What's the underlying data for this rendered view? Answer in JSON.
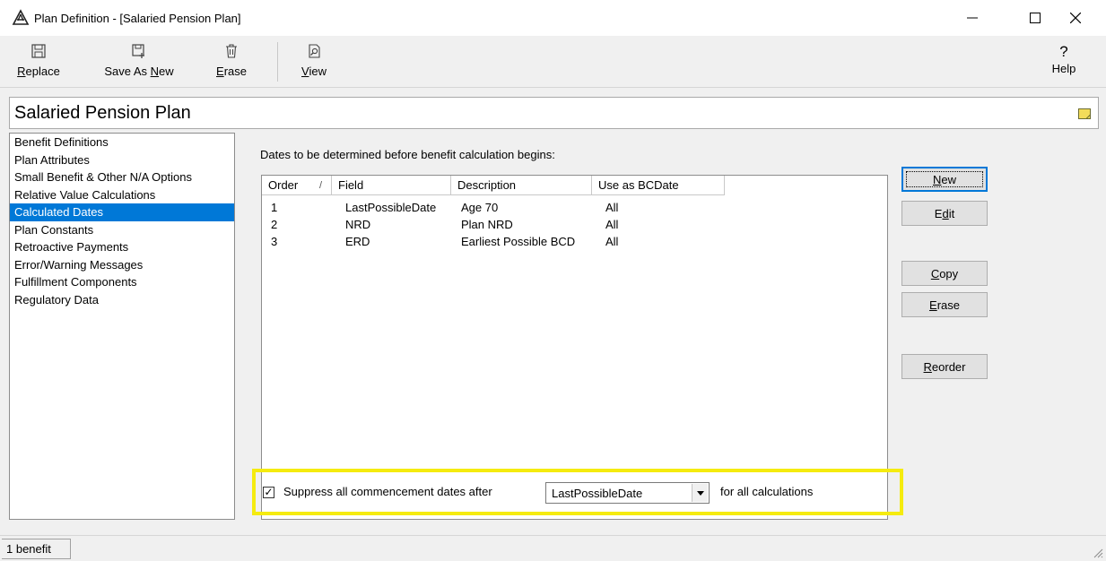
{
  "window": {
    "title": "Plan Definition - [Salaried Pension Plan]"
  },
  "toolbar": {
    "replace": {
      "pre": "",
      "key": "R",
      "post": "eplace",
      "icon": "floppy-disk-icon"
    },
    "save_as_new": {
      "pre": "Save As ",
      "key": "N",
      "post": "ew",
      "icon": "save-as-icon"
    },
    "erase": {
      "pre": "",
      "key": "E",
      "post": "rase",
      "icon": "trash-icon"
    },
    "view": {
      "pre": "",
      "key": "V",
      "post": "iew",
      "icon": "view-icon"
    },
    "help": {
      "glyph": "?",
      "label": "Help"
    }
  },
  "plan": {
    "name": "Salaried Pension Plan"
  },
  "nav": {
    "items": [
      "Benefit Definitions",
      "Plan Attributes",
      "Small Benefit & Other N/A Options",
      "Relative Value Calculations",
      "Calculated Dates",
      "Plan Constants",
      "Retroactive Payments",
      "Error/Warning Messages",
      "Fulfillment Components",
      "Regulatory Data"
    ],
    "selected_index": 4
  },
  "main": {
    "section_label": "Dates to be determined before benefit calculation begins:",
    "columns": [
      "Order",
      "Field",
      "Description",
      "Use as BCDate"
    ],
    "sort_glyph": "/",
    "rows": [
      [
        "1",
        "LastPossibleDate",
        "Age 70",
        "All"
      ],
      [
        "2",
        "NRD",
        "Plan NRD",
        "All"
      ],
      [
        "3",
        "ERD",
        "Earliest Possible BCD",
        "All"
      ]
    ]
  },
  "buttons": {
    "new": {
      "pre": "",
      "key": "N",
      "post": "ew"
    },
    "edit": {
      "pre": "E",
      "key": "d",
      "post": "it"
    },
    "copy": {
      "pre": "",
      "key": "C",
      "post": "opy"
    },
    "erase": {
      "pre": "",
      "key": "E",
      "post": "rase"
    },
    "reorder": {
      "pre": "",
      "key": "R",
      "post": "eorder"
    }
  },
  "suppress": {
    "checked": true,
    "check_glyph": "✓",
    "label": "Suppress all commencement dates after",
    "selected_value": "LastPossibleDate",
    "suffix": "for all calculations",
    "highlight_color": "#f5eb0f"
  },
  "status": {
    "text": "1 benefit"
  },
  "colors": {
    "selection": "#0078d7"
  }
}
